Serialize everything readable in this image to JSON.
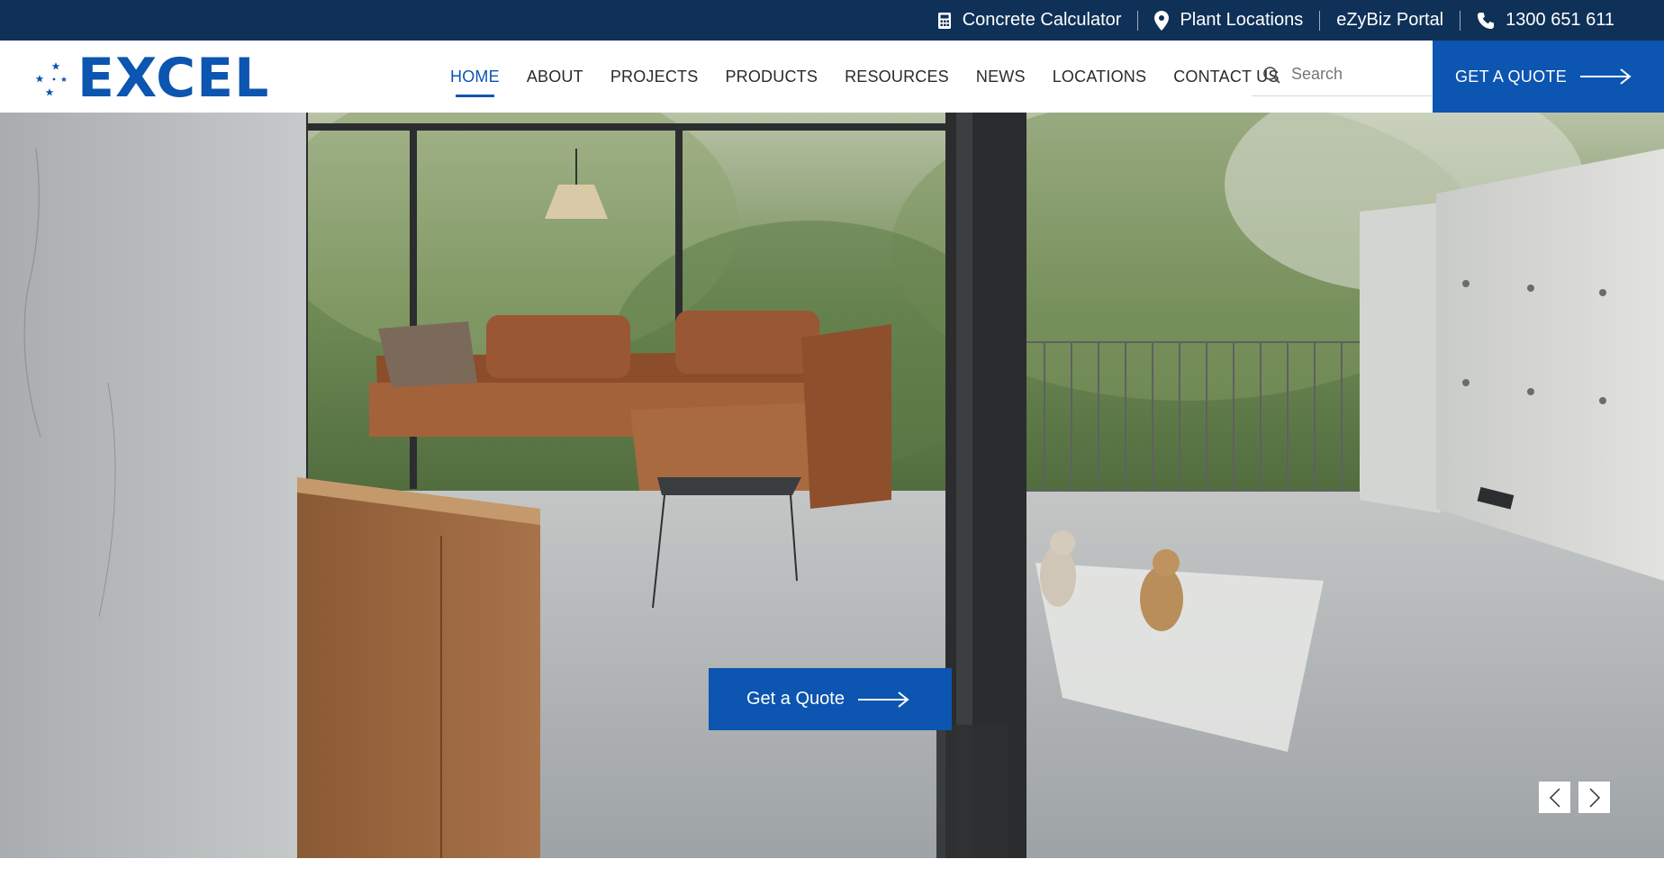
{
  "topbar": {
    "calculator_label": "Concrete Calculator",
    "calculator_icon": "calculator-icon",
    "plant_label": "Plant Locations",
    "plant_icon": "map-pin-icon",
    "portal_label": "eZyBiz Portal",
    "phone_label": "1300 651 611",
    "phone_icon": "phone-icon",
    "background": "#0f3158"
  },
  "brand": {
    "name": "EXCEL",
    "color": "#0c55b0",
    "logo_icon": "southern-cross-stars-icon"
  },
  "nav": {
    "items": [
      {
        "label": "HOME",
        "active": true
      },
      {
        "label": "ABOUT",
        "active": false
      },
      {
        "label": "PROJECTS",
        "active": false
      },
      {
        "label": "PRODUCTS",
        "active": false
      },
      {
        "label": "RESOURCES",
        "active": false
      },
      {
        "label": "NEWS",
        "active": false
      },
      {
        "label": "LOCATIONS",
        "active": false
      },
      {
        "label": "CONTACT US",
        "active": false
      }
    ]
  },
  "search": {
    "placeholder": "Search",
    "value": "",
    "icon": "search-icon"
  },
  "header_cta": {
    "label": "GET A QUOTE",
    "icon": "arrow-right-icon"
  },
  "hero": {
    "cta_label": "Get a Quote",
    "cta_icon": "arrow-right-icon",
    "prev_icon": "chevron-left-icon",
    "next_icon": "chevron-right-icon"
  }
}
